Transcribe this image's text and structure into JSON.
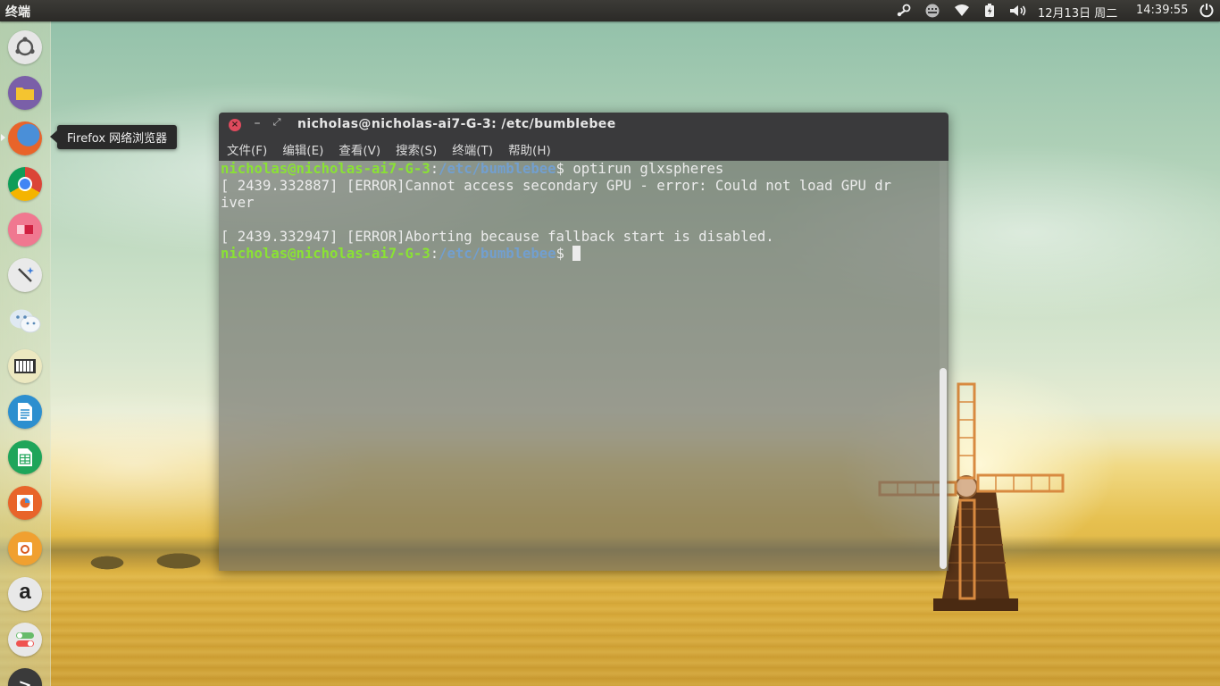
{
  "panel": {
    "app_name": "终端",
    "date": "12月13日 周二",
    "time": "14:39:55",
    "tray_icons": [
      "steam-icon",
      "keyboard-icon",
      "wifi-icon",
      "battery-icon",
      "volume-icon",
      "power-icon"
    ]
  },
  "launcher": {
    "items": [
      {
        "name": "dash-home-icon",
        "color": "#e8e8e8"
      },
      {
        "name": "files-icon",
        "color": "#7a5fa8"
      },
      {
        "name": "firefox-icon",
        "color": "#e8642a"
      },
      {
        "name": "chrome-icon",
        "color": "#e8e8e8"
      },
      {
        "name": "app-pink-icon",
        "color": "#f07890"
      },
      {
        "name": "app-magic-wand-icon",
        "color": "#e8e8e8"
      },
      {
        "name": "wechat-icon",
        "color": "#e8e8e8"
      },
      {
        "name": "piano-icon",
        "color": "#ece8c0"
      },
      {
        "name": "writer-icon",
        "color": "#2d8fcf"
      },
      {
        "name": "calc-icon",
        "color": "#1fa55a"
      },
      {
        "name": "impress-icon",
        "color": "#e8642a"
      },
      {
        "name": "software-center-icon",
        "color": "#f0a030"
      },
      {
        "name": "amazon-icon",
        "color": "#e8e8e8"
      },
      {
        "name": "settings-toggle-icon",
        "color": "#e8e8e8"
      },
      {
        "name": "more-apps-icon",
        "color": "#333333"
      }
    ],
    "tooltip": "Firefox 网络浏览器"
  },
  "terminal": {
    "title": "nicholas@nicholas-ai7-G-3: /etc/bumblebee",
    "menu": [
      "文件(F)",
      "编辑(E)",
      "查看(V)",
      "搜索(S)",
      "终端(T)",
      "帮助(H)"
    ],
    "prompt_user": "nicholas@nicholas-ai7-G-3",
    "prompt_sep": ":",
    "prompt_path": "/etc/bumblebee",
    "prompt_end": "$ ",
    "command": "optirun glxspheres",
    "output_line1": "[ 2439.332887] [ERROR]Cannot access secondary GPU - error: Could not load GPU dr",
    "output_line2": "iver",
    "output_line3": "",
    "output_line4": "[ 2439.332947] [ERROR]Aborting because fallback start is disabled."
  }
}
